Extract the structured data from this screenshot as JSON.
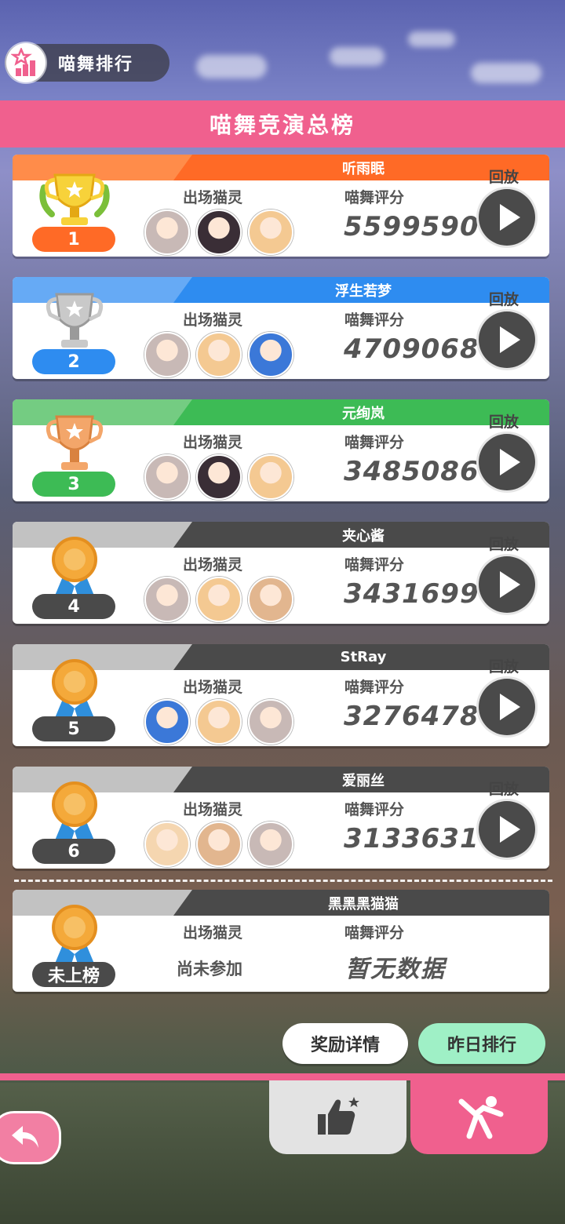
{
  "header": {
    "title": "喵舞排行"
  },
  "banner": {
    "title": "喵舞竞演总榜"
  },
  "labels": {
    "cats": "出场猫灵",
    "score": "喵舞评分",
    "replay": "回放"
  },
  "entries": [
    {
      "rank": "1",
      "name": "听雨眠",
      "score": "5599590",
      "header_color": "#ff6a26",
      "pill_color": "#ff6a26",
      "trophy": "gold-trophy-icon",
      "avatars": [
        "#c8b9b6",
        "#3a2e36",
        "#f4c992"
      ]
    },
    {
      "rank": "2",
      "name": "浮生若梦",
      "score": "4709068",
      "header_color": "#2e8cf0",
      "pill_color": "#2e8cf0",
      "trophy": "silver-trophy-icon",
      "avatars": [
        "#c8b9b6",
        "#f4c992",
        "#3b78d8"
      ]
    },
    {
      "rank": "3",
      "name": "元绚岚",
      "score": "3485086",
      "header_color": "#3dbb55",
      "pill_color": "#3dbb55",
      "trophy": "bronze-trophy-icon",
      "avatars": [
        "#c8b9b6",
        "#3a2e36",
        "#f4c992"
      ]
    },
    {
      "rank": "4",
      "name": "夹心酱",
      "score": "3431699",
      "header_color": "#4a4a4a",
      "pill_color": "#4a4a4a",
      "trophy": "medal-icon",
      "avatars": [
        "#c8b9b6",
        "#f4c992",
        "#e2b68f"
      ]
    },
    {
      "rank": "5",
      "name": "StRay",
      "score": "3276478",
      "header_color": "#4a4a4a",
      "pill_color": "#4a4a4a",
      "trophy": "medal-icon",
      "avatars": [
        "#3b78d8",
        "#f4c992",
        "#c8b9b6"
      ]
    },
    {
      "rank": "6",
      "name": "爱丽丝",
      "score": "3133631",
      "header_color": "#4a4a4a",
      "pill_color": "#4a4a4a",
      "trophy": "medal-icon",
      "avatars": [
        "#f5d6b0",
        "#e2b68f",
        "#c8b9b6"
      ]
    }
  ],
  "me": {
    "rank": "未上榜",
    "name": "黑黑黑猫猫",
    "cats_value": "尚未参加",
    "score_value": "暂无数据"
  },
  "buttons": {
    "reward": "奖励详情",
    "yesterday": "昨日排行"
  }
}
